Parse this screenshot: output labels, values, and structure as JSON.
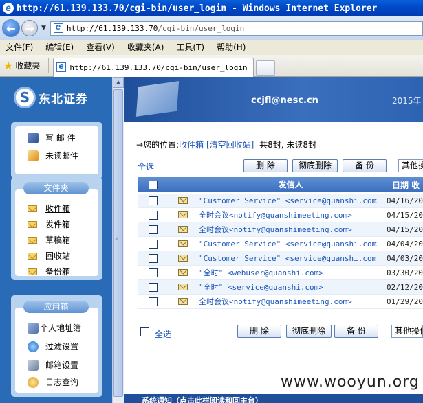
{
  "window": {
    "title": "http://61.139.133.70/cgi-bin/user_login - Windows Internet Explorer"
  },
  "address": {
    "url_host": "http://61.139.133.70",
    "url_path": "/cgi-bin/user_login"
  },
  "menu": [
    "文件(F)",
    "编辑(E)",
    "查看(V)",
    "收藏夹(A)",
    "工具(T)",
    "帮助(H)"
  ],
  "favorites": {
    "label": "收藏夹",
    "tab_title": "http://61.139.133.70/cgi-bin/user_login"
  },
  "brand": {
    "name": "东北证券",
    "logo_char": "S"
  },
  "banner": {
    "email": "ccjfl@nesc.cn",
    "year": "2015年"
  },
  "sidebar": {
    "compose": "写 邮 件",
    "unread": "未读邮件",
    "folders_title": "文件夹",
    "folders": [
      "收件箱",
      "发件箱",
      "草稿箱",
      "回收站",
      "备份箱"
    ],
    "apps_title": "应用箱",
    "apps": [
      "个人地址簿",
      "过滤设置",
      "邮箱设置",
      "日志查询"
    ]
  },
  "location": {
    "prefix": "→您的位置:",
    "current": "收件箱",
    "clear": "[清空回收站]",
    "summary": "共8封, 未读8封"
  },
  "toolbar": {
    "select_all": "全选",
    "delete": "删 除",
    "purge": "彻底删除",
    "backup": "备 份",
    "other_top": "其他操",
    "other_bottom": "其他操作"
  },
  "table": {
    "headers": {
      "sender": "发信人",
      "date": "日期 收"
    },
    "rows": [
      {
        "sender": "\"Customer Service\" <service@quanshi.com>",
        "date": "04/16/20"
      },
      {
        "sender": "全时会议<notify@quanshimeeting.com>",
        "date": "04/15/20"
      },
      {
        "sender": "全时会议<notify@quanshimeeting.com>",
        "date": "04/15/20"
      },
      {
        "sender": "\"Customer Service\" <service@quanshi.com>",
        "date": "04/04/20"
      },
      {
        "sender": "\"Customer Service\" <service@quanshi.com>",
        "date": "04/03/20"
      },
      {
        "sender": "\"全时\" <webuser@quanshi.com>",
        "date": "03/30/20"
      },
      {
        "sender": "\"全时\" <service@quanshi.com>",
        "date": "02/12/20"
      },
      {
        "sender": "全时会议<notify@quanshimeeting.com>",
        "date": "01/29/20"
      }
    ]
  },
  "notice": "系统通知（点击此栏阅读和回主台）",
  "watermark": "www.wooyun.org"
}
